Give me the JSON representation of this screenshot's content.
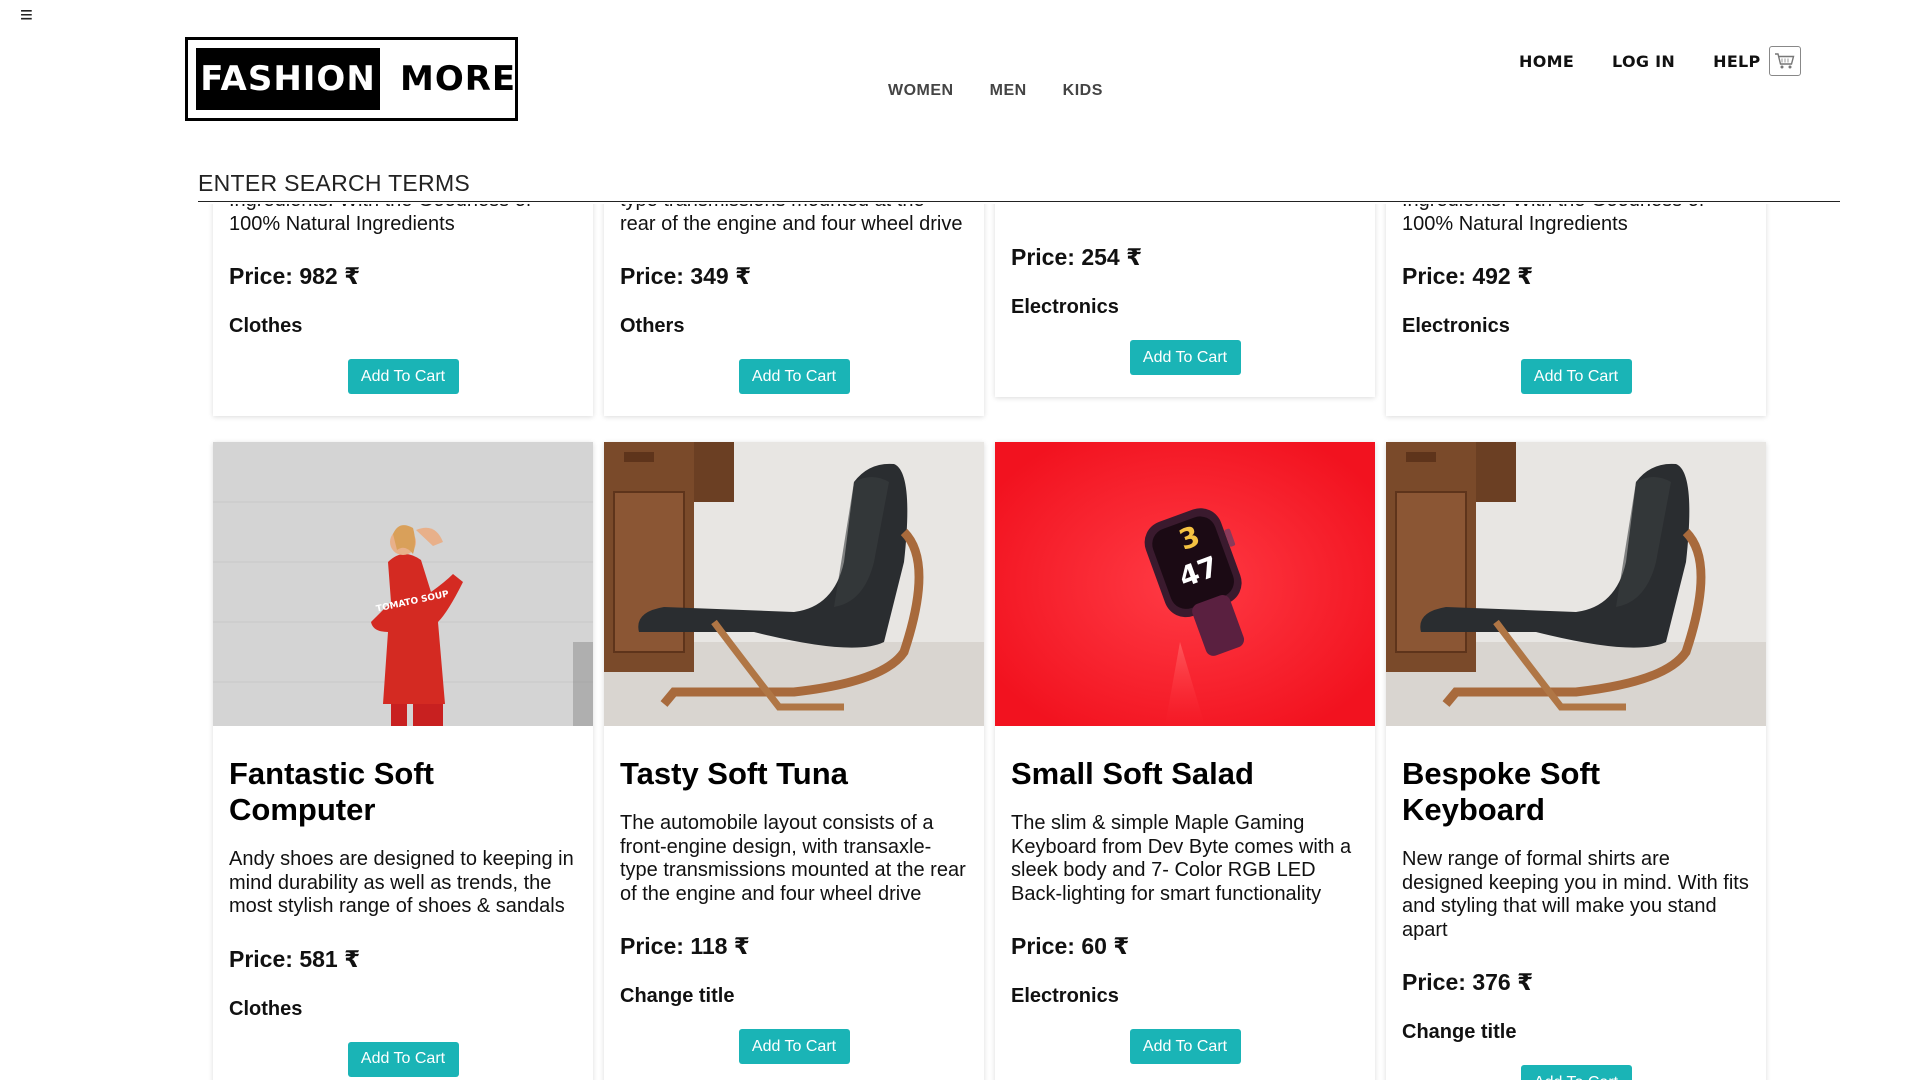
{
  "header": {
    "menu_icon": "≡",
    "logo_left": "FASHION",
    "logo_right": "MORE",
    "categories": [
      "WOMEN",
      "MEN",
      "KIDS"
    ],
    "nav": [
      "HOME",
      "LOG IN",
      "HELP"
    ],
    "cart_icon": "shopping-cart-icon"
  },
  "search": {
    "placeholder": "ENTER SEARCH TERMS"
  },
  "button_color": "#1ab4b6",
  "top_row": [
    {
      "desc_tail": "100% Natural Ingredients",
      "desc_clipped": "Ingredients. With the Goodness of",
      "price": "Price: 982 ₹",
      "category": "Clothes",
      "button": "Add To Cart"
    },
    {
      "desc_tail": "rear of the engine and four wheel drive",
      "desc_clipped": "type transmissions mounted at the",
      "price": "Price: 349 ₹",
      "category": "Others",
      "button": "Add To Cart"
    },
    {
      "desc_tail": "",
      "desc_clipped": "",
      "price": "Price: 254 ₹",
      "category": "Electronics",
      "button": "Add To Cart"
    },
    {
      "desc_tail": "100% Natural Ingredients",
      "desc_clipped": "Ingredients. With the Goodness of",
      "price": "Price: 492 ₹",
      "category": "Electronics",
      "button": "Add To Cart"
    }
  ],
  "bottom_row": [
    {
      "image": "woman-red-sweater-photo",
      "title": "Fantastic Soft Computer",
      "desc": "Andy shoes are designed to keeping in mind durability as well as trends, the most stylish range of shoes & sandals",
      "price": "Price: 581 ₹",
      "category": "Clothes",
      "button": "Add To Cart"
    },
    {
      "image": "black-armchair-photo",
      "title": "Tasty Soft Tuna",
      "desc": "The automobile layout consists of a front-engine design, with transaxle-type transmissions mounted at the rear of the engine and four wheel drive",
      "price": "Price: 118 ₹",
      "category": "Change title",
      "button": "Add To Cart"
    },
    {
      "image": "smartwatch-red-background-photo",
      "title": "Small Soft Salad",
      "desc": "The slim & simple Maple Gaming Keyboard from Dev Byte comes with a sleek body and 7- Color RGB LED Back-lighting for smart functionality",
      "price": "Price: 60 ₹",
      "category": "Electronics",
      "button": "Add To Cart"
    },
    {
      "image": "black-armchair-photo",
      "title": "Bespoke Soft Keyboard",
      "desc": "New range of formal shirts are designed keeping you in mind. With fits and styling that will make you stand apart",
      "price": "Price: 376 ₹",
      "category": "Change title",
      "button": "Add To Cart"
    }
  ],
  "watch_display": "3\n47",
  "sweater_text": "TOMATO SOUP"
}
